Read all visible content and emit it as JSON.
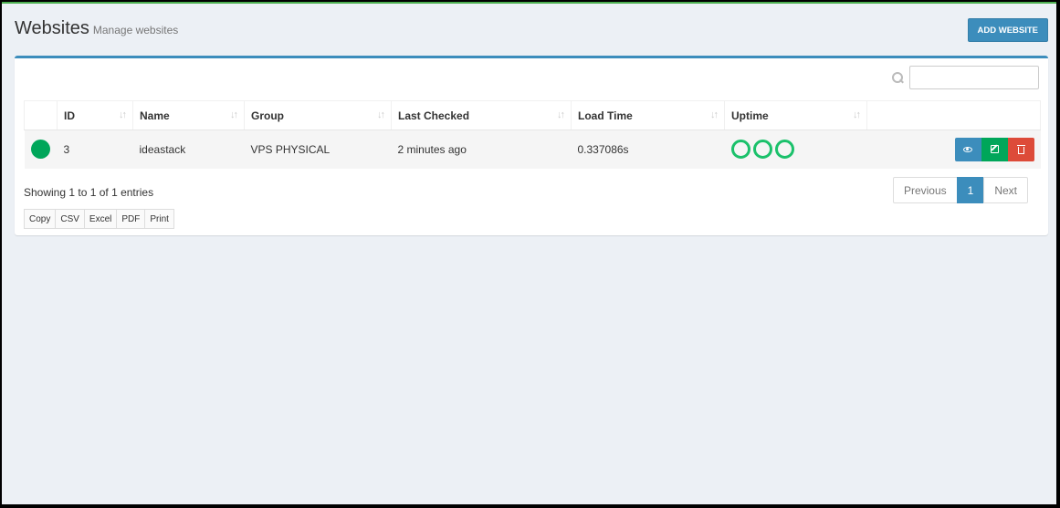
{
  "header": {
    "title": "Websites",
    "subtitle": "Manage websites",
    "add_button": "ADD WEBSITE"
  },
  "search": {
    "placeholder": ""
  },
  "table": {
    "columns": [
      "",
      "ID",
      "Name",
      "Group",
      "Last Checked",
      "Load Time",
      "Uptime",
      ""
    ],
    "rows": [
      {
        "status": "online",
        "id": "3",
        "name": "ideastack",
        "group": "VPS PHYSICAL",
        "last_checked": "2 minutes ago",
        "load_time": "0.337086s",
        "uptime_indicators": 3
      }
    ]
  },
  "info": "Showing 1 to 1 of 1 entries",
  "pagination": {
    "previous": "Previous",
    "current": "1",
    "next": "Next"
  },
  "export": {
    "copy": "Copy",
    "csv": "CSV",
    "excel": "Excel",
    "pdf": "PDF",
    "print": "Print"
  },
  "icons": {
    "sort": "sort-icon",
    "search": "search-icon",
    "view": "eye-icon",
    "edit": "edit-icon",
    "delete": "trash-icon"
  },
  "colors": {
    "primary": "#3c8dbc",
    "success": "#00a65a",
    "danger": "#dd4b39",
    "uptime_ring": "#1bc16b",
    "background": "#ecf0f5"
  }
}
